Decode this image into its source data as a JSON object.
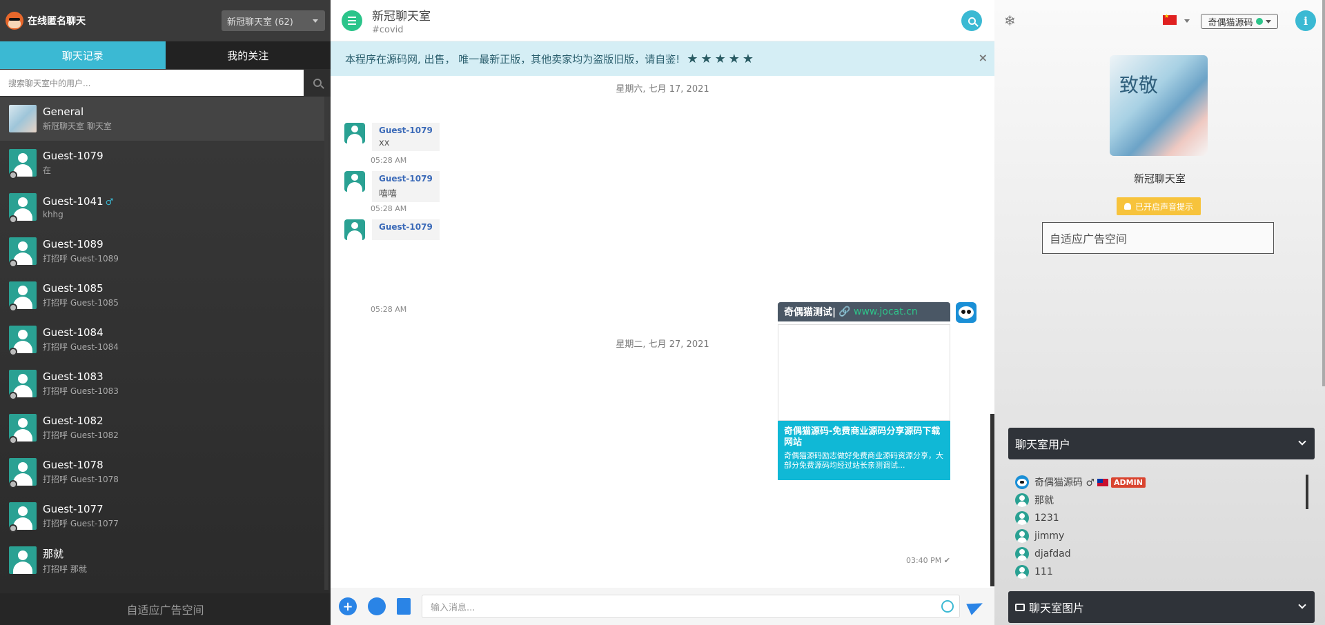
{
  "app": {
    "title": "在线匿名聊天"
  },
  "room_select": {
    "value": "新冠聊天室 (62)"
  },
  "tabs": [
    {
      "label": "聊天记录"
    },
    {
      "label": "我的关注"
    }
  ],
  "search": {
    "placeholder": "搜索聊天室中的用户..."
  },
  "chat_list": [
    {
      "name": "General",
      "sub": "新冠聊天室 聊天室"
    },
    {
      "name": "Guest-1079",
      "sub": "在"
    },
    {
      "name": "Guest-1041",
      "sub": "khhg",
      "gender": "♂"
    },
    {
      "name": "Guest-1089",
      "sub": "打招呼 Guest-1089"
    },
    {
      "name": "Guest-1085",
      "sub": "打招呼 Guest-1085"
    },
    {
      "name": "Guest-1084",
      "sub": "打招呼 Guest-1084"
    },
    {
      "name": "Guest-1083",
      "sub": "打招呼 Guest-1083"
    },
    {
      "name": "Guest-1082",
      "sub": "打招呼 Guest-1082"
    },
    {
      "name": "Guest-1078",
      "sub": "打招呼 Guest-1078"
    },
    {
      "name": "Guest-1077",
      "sub": "打招呼 Guest-1077"
    },
    {
      "name": "那就",
      "sub": "打招呼 那就"
    }
  ],
  "left_ad": "自适应广告空间",
  "header": {
    "room_name": "新冠聊天室",
    "room_tag": "#covid"
  },
  "notice": {
    "text": "本程序在源码网, 出售， 唯一最新正版，其他卖家均为盗版旧版，请自鉴!",
    "stars": "★★★★★",
    "close": "×"
  },
  "dates": [
    "星期六, 七月 17, 2021",
    "星期二, 七月 27, 2021"
  ],
  "messages": [
    {
      "user": "Guest-1079",
      "text": "xx",
      "time": "05:28 AM"
    },
    {
      "user": "Guest-1079",
      "text": "嘻嘻",
      "time": "05:28 AM"
    },
    {
      "user": "Guest-1079",
      "text": "",
      "time": "05:28 AM"
    }
  ],
  "rich_message": {
    "sender": "奇偶猫测试|",
    "link": "🔗 www.jocat.cn",
    "card_title": "奇偶猫源码-免费商业源码分享源码下载网站",
    "card_desc": "奇偶猫源码励志做好免费商业源码资源分享，大部分免费源码均经过站长亲测调试...",
    "time": "03:40 PM ✔"
  },
  "composer": {
    "placeholder": "输入消息..."
  },
  "right": {
    "snow": "❄",
    "user_menu": "奇偶猫源码",
    "info": "i",
    "room_pic_text": "致敬",
    "room_name": "新冠聊天室",
    "sound_badge": "已开启声音提示",
    "ad": "自适应广告空间",
    "users_panel": "聊天室用户",
    "images_panel": "聊天室图片",
    "users": [
      {
        "name": "奇偶猫源码 ♂",
        "admin": "ADMIN"
      },
      {
        "name": "那就"
      },
      {
        "name": "1231"
      },
      {
        "name": "jimmy"
      },
      {
        "name": "djafdad"
      },
      {
        "name": "111"
      }
    ]
  }
}
